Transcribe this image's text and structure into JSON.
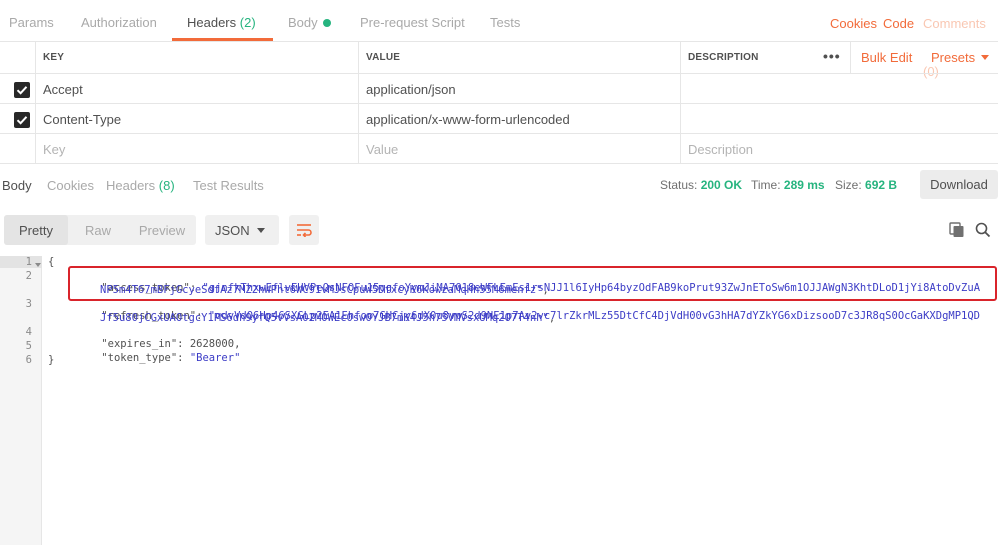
{
  "request_tabs": [
    {
      "label": "Params"
    },
    {
      "label": "Authorization"
    },
    {
      "label": "Headers",
      "count": "(2)"
    },
    {
      "label": "Body"
    },
    {
      "label": "Pre-request Script"
    },
    {
      "label": "Tests"
    }
  ],
  "request_links": {
    "cookies": "Cookies",
    "code": "Code",
    "comments": "Comments (0)"
  },
  "headers_table": {
    "columns": [
      "KEY",
      "VALUE",
      "DESCRIPTION"
    ],
    "more": "•••",
    "bulk_edit": "Bulk Edit",
    "presets": "Presets",
    "rows": [
      {
        "key": "Accept",
        "value": "application/json",
        "description": ""
      },
      {
        "key": "Content-Type",
        "value": "application/x-www-form-urlencoded",
        "description": ""
      }
    ],
    "placeholders": {
      "key": "Key",
      "value": "Value",
      "description": "Description"
    }
  },
  "response_tabs": [
    {
      "label": "Body"
    },
    {
      "label": "Cookies"
    },
    {
      "label": "Headers",
      "count": "(8)"
    },
    {
      "label": "Test Results"
    }
  ],
  "response_status": {
    "status_label": "Status:",
    "status": "200 OK",
    "time_label": "Time:",
    "time": "289 ms",
    "size_label": "Size:",
    "size": "692 B"
  },
  "download_label": "Download",
  "format_buttons": [
    "Pretty",
    "Raw",
    "Preview"
  ],
  "language": "JSON",
  "code": {
    "line_numbers": [
      "1",
      "2",
      "3",
      "4",
      "5",
      "6"
    ],
    "open_brace": "{",
    "close_brace": "}",
    "access_token_key": "\"access_token\"",
    "access_token_part1": "\"gjnfkThxwEflvEHVPeQsNFOFu15qgfoYymJiMA7O18eWFLEmEs1rsNJJ1l6IyHp64byzOdFAB9koPrut93ZwJnEToSw6m1OJJAWgN3KhtDLoD1jYi8AtoDvZuA",
    "access_token_part2": "NP5m4T67mBFjGcyeSdfAz7MZ2hWPht6WC91vMJsCpuW5DfxcyK6KowzaMqHh55M6menfz\"",
    "refresh_token_key": "\"refresh_token\"",
    "refresh_token_part1": "\"qdvVdQ6Hp46SXGLp2EA1Ehfoo7GHCjy6dX0u8vpS2d9NE1p7Av2vc7lrZkrMLz55DtCfC4DjVdH00vG3hHA7dYZkYG6xDizsooD7c3JR8qS0OcGaKXDgMP1QD",
    "refresh_token_part2": "Jf5u80jCGxUAOtgcY1PS6dh9yfQ5vVsA02MOWEc0sw0YJB7mK4J5h75VMVsxUMq2O7T4nh\"",
    "expires_in_key": "\"expires_in\"",
    "expires_in_value": "2628000",
    "token_type_key": "\"token_type\"",
    "token_type_value": "\"Bearer\""
  },
  "colors": {
    "accent": "#f26b3a",
    "success": "#26b47f",
    "highlight": "#d9242b"
  }
}
